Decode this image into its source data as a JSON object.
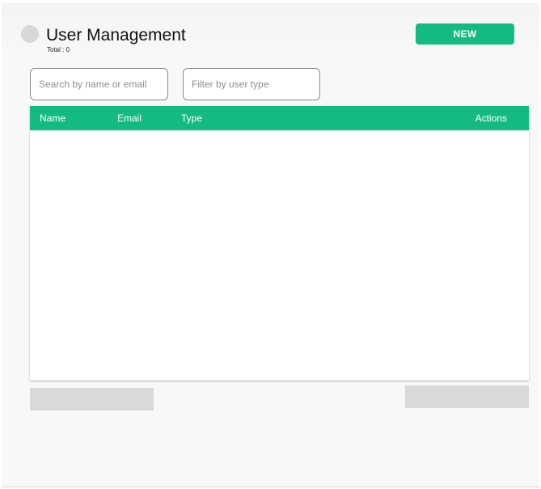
{
  "header": {
    "title": "User Management",
    "total": "Total : 0",
    "new_label": "NEW"
  },
  "filters": {
    "search_placeholder": "Search by name or email",
    "type_placeholder": "Filter by user type"
  },
  "table": {
    "columns": [
      "Name",
      "Email",
      "Type",
      "Actions"
    ],
    "rows": []
  },
  "colors": {
    "accent": "#13bb81",
    "placeholder_block": "#d9d9d9"
  }
}
